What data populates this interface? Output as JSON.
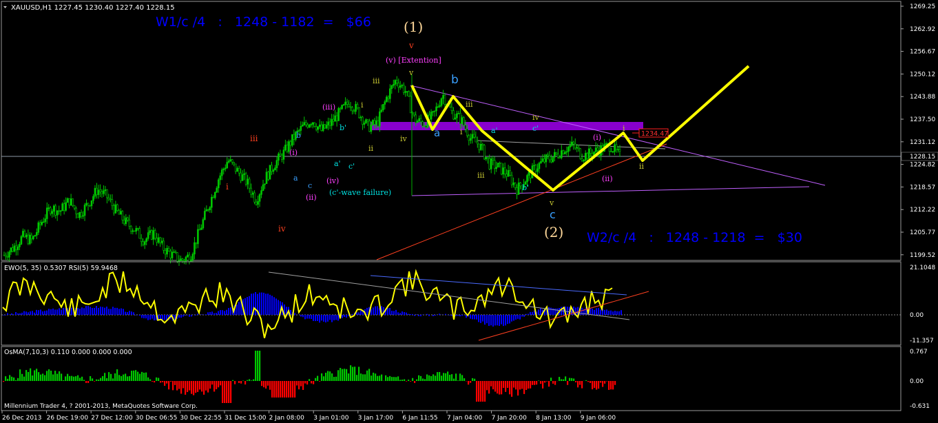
{
  "window": {
    "symbol_header": "XAUUSD,H1  1227.45 1230.40 1227.40 1228.15",
    "copyright": "Millennium Trader 4, ? 2001-2013, MetaQuotes Software Corp."
  },
  "colors": {
    "background": "#000000",
    "bull_candle": "#00c800",
    "wave_path": "#ffff00",
    "ewo_bars": "#0000ff",
    "rsi_line": "#ffff00",
    "osma_up": "#00c800",
    "osma_down": "#ff0000",
    "annotation_blue": "#0000ff",
    "trendline": "#ff4020",
    "channel": "#c060ff",
    "zone": "#8800cc"
  },
  "main_panel": {
    "price_axis": [
      "1269.25",
      "1262.92",
      "1256.67",
      "1250.12",
      "1243.88",
      "1237.50",
      "1231.12",
      "1224.82",
      "1218.57",
      "1212.22",
      "1205.77",
      "1199.52"
    ],
    "current_price_label": "1228.15",
    "price_tag": "1234.47",
    "headline_w1": "W1/c /4   :   1248 - 1182  =   $66",
    "headline_w2": "W2/c /4   :   1248 - 1218  =   $30",
    "wave_labels": {
      "big1": "(1)",
      "big2": "(2)",
      "v_orange": "v",
      "v_ext": "(v) [Extention]",
      "v_small": "v",
      "b_big": "b",
      "a_big": "a",
      "c_big": "c",
      "iii_red": "iii",
      "i_red": "i",
      "iv_red": "iv",
      "iii_pink": "(iii)",
      "i_pink": "(i)",
      "ii_pink": "(ii)",
      "iv_pink": "(iv)",
      "iii_y1": "iii",
      "i_y1": "i",
      "ii_y1": "ii",
      "b_small": "b",
      "a_small": "a",
      "c_small": "c",
      "b_prime": "b'",
      "a_prime": "a'",
      "c_prime": "c'",
      "fail": "(c'-wave failure)",
      "iv_y": "iv",
      "iii_y2": "iii",
      "i_y2": "i",
      "iii_y3": "iii",
      "a_prime2": "a'",
      "iv_y2": "iv",
      "c_prime2": "c'",
      "b_prime2": "b'",
      "v_y2": "v",
      "i_pink2": "(i)",
      "ii_pink2": "(ii)",
      "i_w": "i",
      "ii_w": "ii"
    }
  },
  "ewo_panel": {
    "header": "EWO(5, 35) 0.5307  RSI(5) 59.9468",
    "axis": [
      "21.1048",
      "0.00",
      "-11.357"
    ]
  },
  "osma_panel": {
    "header": "OsMA(7,10,3) 0.110 0.000 0.000 0.000",
    "axis": [
      "0.767",
      "0.00",
      "-0.631"
    ]
  },
  "time_axis": [
    "26 Dec 2013",
    "26 Dec 19:00",
    "27 Dec 12:00",
    "30 Dec 06:55",
    "30 Dec 22:55",
    "31 Dec 15:00",
    "2 Jan 08:00",
    "3 Jan 01:00",
    "3 Jan 17:00",
    "6 Jan 11:55",
    "7 Jan 04:00",
    "7 Jan 20:00",
    "8 Jan 13:00",
    "9 Jan 06:00"
  ],
  "chart_data": {
    "type": "line",
    "title": "XAUUSD,H1  1227.45 1230.40 1227.40 1228.15",
    "xlabel": "",
    "ylabel": "",
    "ylim": [
      1199.52,
      1269.25
    ],
    "close_price_path": [
      1201,
      1203,
      1206,
      1205,
      1210,
      1214,
      1213,
      1216,
      1212,
      1215,
      1219,
      1217,
      1213,
      1210,
      1208,
      1205,
      1207,
      1203,
      1201,
      1199.5,
      1201,
      1208,
      1215,
      1222,
      1227,
      1224,
      1221,
      1216,
      1222,
      1226,
      1229,
      1233,
      1236,
      1238,
      1235,
      1237,
      1240,
      1243,
      1240,
      1236,
      1237,
      1244,
      1249,
      1246,
      1238,
      1237,
      1239,
      1245,
      1240,
      1238,
      1233,
      1231,
      1226,
      1225,
      1223,
      1219,
      1222,
      1225,
      1227,
      1228,
      1230,
      1231,
      1228,
      1229,
      1230,
      1231,
      1228
    ],
    "wave_projection": {
      "series": [
        {
          "name": "",
          "x": [
            "6 Jan 11:55",
            "6 Jan 18:00",
            "7 Jan 04:00",
            "8 Jan 13:00",
            "9 Jan 10:00",
            "9 Jan 14:00",
            "10 Jan"
          ],
          "values": [
            1248,
            1237,
            1245,
            1220,
            1237,
            1226,
            1252
          ]
        }
      ]
    },
    "annotations": [
      "W1/c /4   :   1248 - 1182  =   $66",
      "W2/c /4   :   1248 - 1218  =   $30"
    ]
  }
}
